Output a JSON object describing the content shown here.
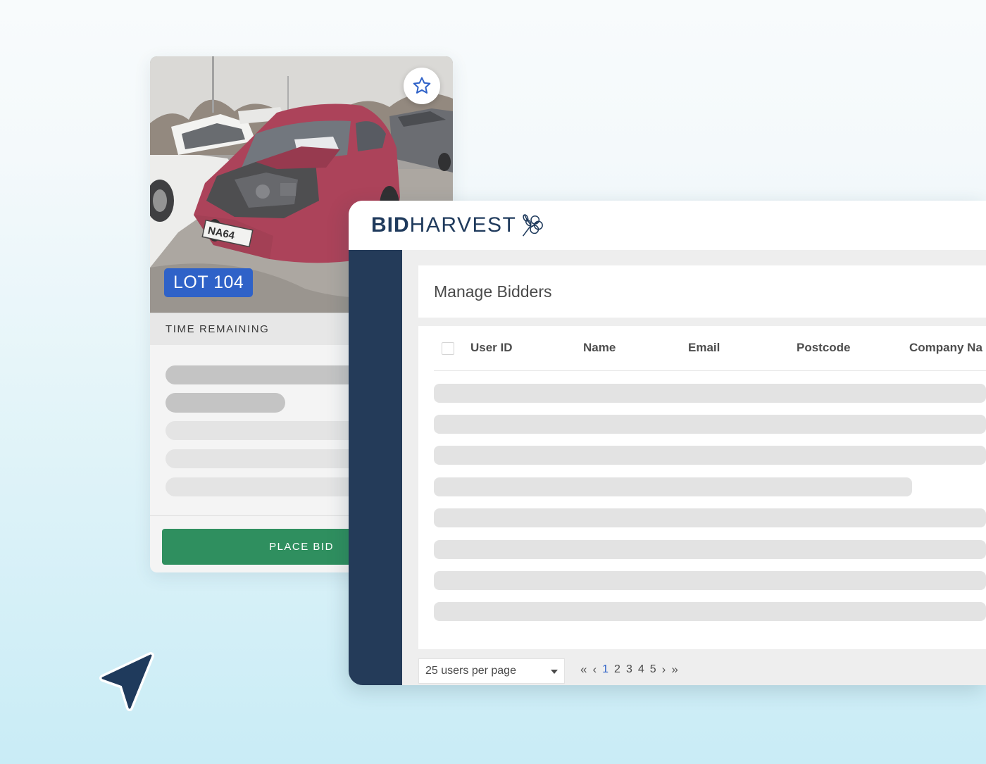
{
  "lot_card": {
    "lot_label": "LOT 104",
    "plate_text": "NA64",
    "time_remaining_label": "TIME REMAINING",
    "place_bid_label": "PLACE BID",
    "favorite_icon": "star-icon"
  },
  "admin": {
    "logo_bold": "BID",
    "logo_light": "HARVEST",
    "logo_icon": "wheat-bundle-icon",
    "page_title": "Manage Bidders",
    "columns": [
      "User ID",
      "Name",
      "Email",
      "Postcode",
      "Company Na"
    ],
    "per_page": "25 users per page",
    "pagination": {
      "first_icon": "double-chevron-left-icon",
      "prev_icon": "chevron-left-icon",
      "pages": [
        "1",
        "2",
        "3",
        "4",
        "5"
      ],
      "current_page": "1",
      "next_icon": "chevron-right-icon",
      "last_icon": "double-chevron-right-icon"
    }
  },
  "colors": {
    "sidebar": "#243b59",
    "accent_blue": "#2f62c8",
    "bid_green": "#2f8f5f",
    "logo_navy": "#1f3a5c"
  },
  "decor": {
    "pointer_icon": "navigation-arrow-icon"
  }
}
